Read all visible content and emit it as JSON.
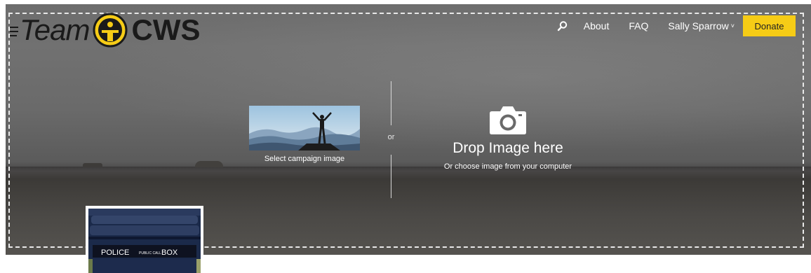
{
  "logo": {
    "team_text": "Team",
    "brand_text": "CWS",
    "icon": "cws-emblem-icon"
  },
  "nav": {
    "search_icon": "search-icon",
    "links": [
      "About",
      "FAQ"
    ],
    "user_name": "Sally Sparrow",
    "user_chevron": "˅",
    "donate_label": "Donate"
  },
  "upload": {
    "select_caption": "Select campaign image",
    "or_label": "or",
    "drop_title": "Drop Image here",
    "drop_subtitle": "Or choose image from your computer",
    "camera_icon": "camera-icon"
  },
  "avatar": {
    "sign_left": "POLICE",
    "sign_mid": "PUBLIC CALL",
    "sign_right": "BOX"
  },
  "colors": {
    "donate_bg": "#f6cc16",
    "logo_yellow": "#f6cc16",
    "text_white": "#ffffff"
  }
}
